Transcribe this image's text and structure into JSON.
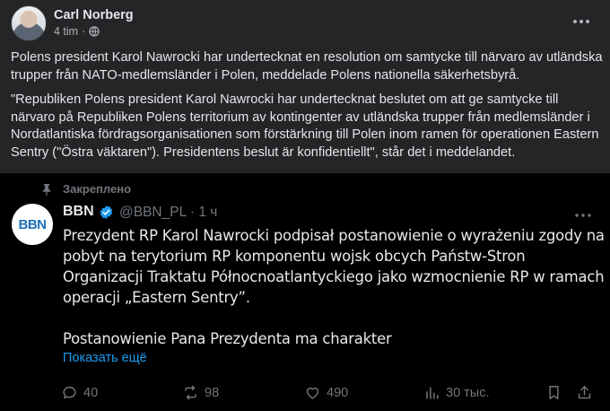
{
  "post": {
    "author": "Carl Norberg",
    "time": "4 tim",
    "separator": "·",
    "paragraphs": [
      "Polens president Karol Nawrocki har undertecknat en resolution om samtycke till närvaro av utländska trupper från NATO-medlemsländer i Polen, meddelade Polens nationella säkerhetsbyrå.",
      "\"Republiken Polens president Karol Nawrocki har undertecknat beslutet om att ge samtycke till närvaro på Republiken Polens territorium av kontingenter av utländska trupper från medlemsländer i Nordatlantiska fördragsorganisationen som förstärkning till Polen inom ramen för operationen Eastern Sentry (\"Östra väktaren\"). Presidentens beslut är konfidentiellt\", står det i meddelandet."
    ]
  },
  "tweet": {
    "pinned_label": "Закреплено",
    "avatar_text": "BBN",
    "name": "BBN",
    "handle_time": "@BBN_PL · 1 ч",
    "body_1": "Prezydent RP Karol Nawrocki podpisał postanowienie o wyrażeniu zgody na pobyt na terytorium RP komponentu wojsk obcych Państw-Stron Organizacji Traktatu Północnoatlantyckiego jako wzmocnienie RP w ramach operacji „Eastern Sentry”.",
    "body_2": "Postanowienie Pana Prezydenta ma charakter",
    "show_more": "Показать ещё",
    "replies": "40",
    "reposts": "98",
    "likes": "490",
    "views": "30 тыс."
  },
  "colors": {
    "fb_bg": "#242526",
    "tweet_bg": "#000000",
    "link_blue": "#1d9bf0",
    "muted": "#71767b"
  },
  "icons": [
    "globe-icon",
    "more-horizontal-icon",
    "pin-icon",
    "verified-badge-icon",
    "reply-icon",
    "repost-icon",
    "like-icon",
    "views-icon",
    "bookmark-icon",
    "share-icon"
  ]
}
